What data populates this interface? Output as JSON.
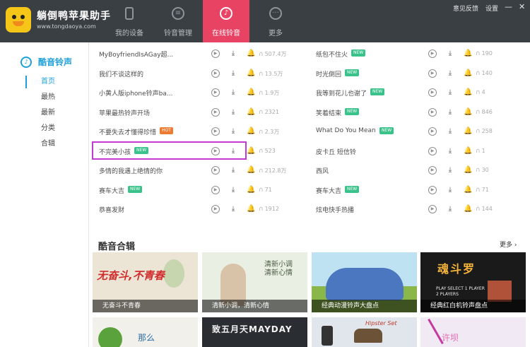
{
  "app": {
    "title": "躺倒鸭苹果助手",
    "url": "www.tongdaoya.com"
  },
  "nav": {
    "tabs": [
      {
        "label": "我的设备",
        "icon": "phone-icon"
      },
      {
        "label": "铃音管理",
        "icon": "ringtone-manage-icon"
      },
      {
        "label": "在线铃音",
        "icon": "music-note-icon",
        "active": true
      },
      {
        "label": "更多",
        "icon": "more-icon"
      }
    ]
  },
  "top_links": {
    "feedback": "意见反馈",
    "settings": "设置",
    "minimize": "—",
    "close": "✕"
  },
  "sidebar": {
    "header": "酷音铃声",
    "items": [
      {
        "label": "首页",
        "active": true
      },
      {
        "label": "最热"
      },
      {
        "label": "最新"
      },
      {
        "label": "分类"
      },
      {
        "label": "合辑"
      }
    ]
  },
  "ringtones": {
    "left": [
      {
        "name": "MyBoyfriendIsAGay超...",
        "plays": "507.4万"
      },
      {
        "name": "我们不谈这样的",
        "plays": "13.5万"
      },
      {
        "name": "小黄人版iphone铃声ba...",
        "plays": "1.9万"
      },
      {
        "name": "苹果最热铃声开场",
        "plays": "2321"
      },
      {
        "name": "不要失去才懂得珍惜",
        "badge": "HOT",
        "plays": "2.3万"
      },
      {
        "name": "不完美小孩",
        "badge": "NEW",
        "plays": "523"
      },
      {
        "name": "多情的我遇上绝情的你",
        "plays": "212.8万"
      },
      {
        "name": "赛车大吉",
        "badge": "NEW",
        "plays": "71"
      },
      {
        "name": "恭喜发财",
        "plays": "1912"
      }
    ],
    "right": [
      {
        "name": "纸包不住火",
        "badge": "NEW",
        "plays": "190"
      },
      {
        "name": "时光倒回",
        "badge": "NEW",
        "plays": "140"
      },
      {
        "name": "我等到花儿也谢了",
        "badge": "NEW",
        "plays": "4"
      },
      {
        "name": "笑着结束",
        "badge": "NEW",
        "plays": "846"
      },
      {
        "name": "What Do You Mean",
        "badge": "NEW",
        "plays": "258"
      },
      {
        "name": "皮卡丘 短信铃",
        "plays": "1"
      },
      {
        "name": "西风",
        "plays": "30"
      },
      {
        "name": "赛车大吉",
        "badge": "NEW",
        "plays": "71"
      },
      {
        "name": "炫电快手热播",
        "plays": "144"
      }
    ]
  },
  "collections": {
    "title": "酷音合辑",
    "more": "更多 ›",
    "cards": [
      {
        "caption": "无奋斗不青春",
        "art": "无奋斗,不青春"
      },
      {
        "caption": "清新小调，清新心情",
        "art": "清新小调 清新心情"
      },
      {
        "caption": "经典动漫铃声大盘点"
      },
      {
        "caption": "经典红白机铃声盘点",
        "art": "魂斗罗",
        "art2": "PLAY SELECT 1 PLAYER 2 PLAYERS"
      },
      {
        "art": "那么"
      },
      {
        "art": "致五月天MAYDAY"
      },
      {
        "art": "Hipster Set"
      },
      {
        "art": "许坝"
      }
    ]
  },
  "icons": {
    "play": "▶",
    "download": "⤓",
    "bell": "🔔",
    "plays": "🎧"
  },
  "colors": {
    "accent_tab": "#e94364",
    "accent_blue": "#1fa0d8",
    "badge_new": "#39c28a",
    "badge_hot": "#ee7a32",
    "highlight": "#c23ad0"
  }
}
